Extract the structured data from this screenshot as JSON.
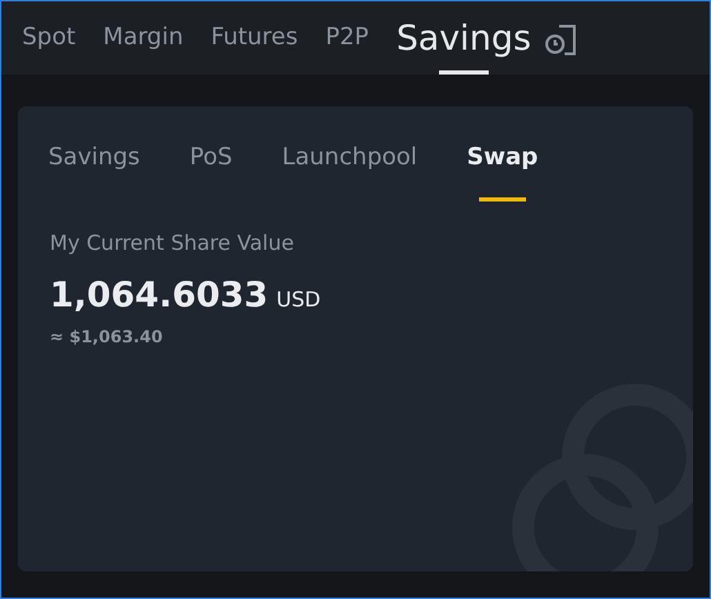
{
  "top_tabs": [
    {
      "label": "Spot",
      "selected": false
    },
    {
      "label": "Margin",
      "selected": false
    },
    {
      "label": "Futures",
      "selected": false
    },
    {
      "label": "P2P",
      "selected": false
    },
    {
      "label": "Savings",
      "selected": true
    }
  ],
  "card": {
    "tabs": [
      {
        "label": "Savings",
        "selected": false
      },
      {
        "label": "PoS",
        "selected": false
      },
      {
        "label": "Launchpool",
        "selected": false
      },
      {
        "label": "Swap",
        "selected": true
      }
    ],
    "label": "My Current Share Value",
    "amount": "1,064.6033",
    "currency": "USD",
    "approx": "≈ $1,063.40"
  }
}
